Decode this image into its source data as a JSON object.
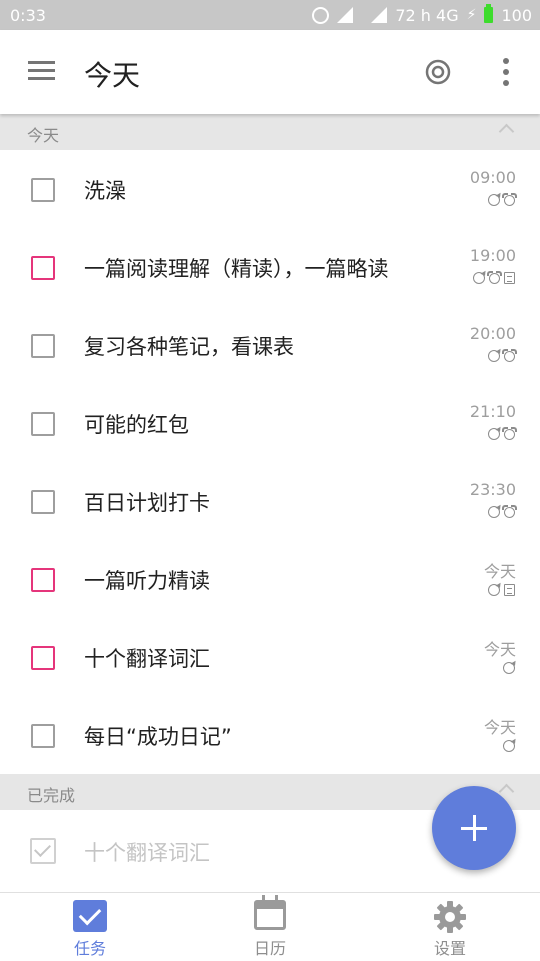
{
  "status_bar": {
    "time": "0:33",
    "signal_info": "72  h 4G",
    "battery": "100",
    "icons": [
      "alarm-icon",
      "signal-icon",
      "signal-icon",
      "data-arrows-icon",
      "charging-icon",
      "battery-icon"
    ]
  },
  "app_bar": {
    "title": "今天",
    "icons": [
      "menu-icon",
      "focus-target-icon",
      "more-vert-icon"
    ]
  },
  "sections": {
    "today_label": "今天",
    "completed_label": "已完成"
  },
  "tasks": [
    {
      "title": "洗澡",
      "time": "09:00",
      "priority_color": "#9e9e9e",
      "meta": [
        "repeat",
        "alarm"
      ]
    },
    {
      "title": "一篇阅读理解（精读），一篇略读",
      "time": "19:00",
      "priority_color": "#e5357b",
      "meta": [
        "repeat",
        "alarm",
        "note"
      ]
    },
    {
      "title": "复习各种笔记，看课表",
      "time": "20:00",
      "priority_color": "#9e9e9e",
      "meta": [
        "repeat",
        "alarm"
      ]
    },
    {
      "title": "可能的红包",
      "time": "21:10",
      "priority_color": "#9e9e9e",
      "meta": [
        "repeat",
        "alarm"
      ]
    },
    {
      "title": "百日计划打卡",
      "time": "23:30",
      "priority_color": "#9e9e9e",
      "meta": [
        "repeat",
        "alarm"
      ]
    },
    {
      "title": "一篇听力精读",
      "time": "今天",
      "priority_color": "#e5357b",
      "meta": [
        "repeat",
        "note"
      ]
    },
    {
      "title": "十个翻译词汇",
      "time": "今天",
      "priority_color": "#e5357b",
      "meta": [
        "repeat"
      ]
    },
    {
      "title": "每日“成功日记”",
      "time": "今天",
      "priority_color": "#9e9e9e",
      "meta": [
        "repeat"
      ]
    }
  ],
  "completed_tasks": [
    {
      "title": "十个翻译词汇"
    }
  ],
  "fab": {
    "icon": "plus-icon",
    "color": "#5f7ddb"
  },
  "bottom_nav": [
    {
      "label": "任务",
      "icon": "task-check-icon",
      "active": true
    },
    {
      "label": "日历",
      "icon": "calendar-icon",
      "active": false
    },
    {
      "label": "设置",
      "icon": "settings-gear-icon",
      "active": false
    }
  ],
  "colors": {
    "accent": "#5f7ddb",
    "high_priority": "#e5357b",
    "status_bar": "#c7c7c7"
  }
}
